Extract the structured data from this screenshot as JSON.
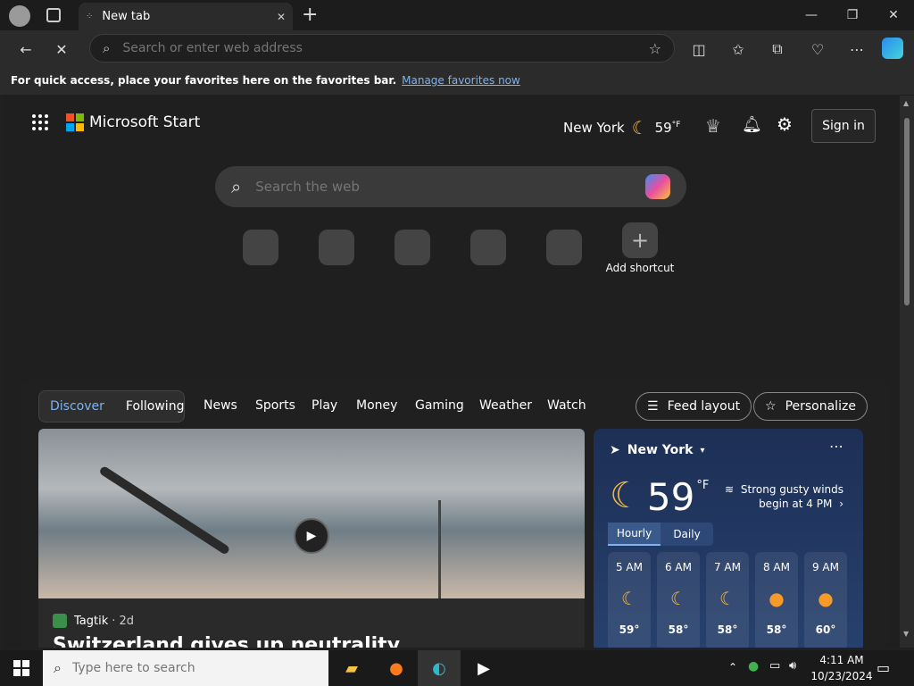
{
  "window": {
    "tab_title": "New tab",
    "close_tab": "✕",
    "new_tab": "+",
    "minimize": "—",
    "maximize": "❐",
    "close": "✕"
  },
  "toolbar": {
    "address_placeholder": "Search or enter web address"
  },
  "favbar": {
    "message": "For quick access, place your favorites here on the favorites bar.",
    "manage_link": "Manage favorites now"
  },
  "header": {
    "brand": "Microsoft Start",
    "city": "New York",
    "temp": "59",
    "unit": "°F",
    "sign_in": "Sign in"
  },
  "search": {
    "placeholder": "Search the web"
  },
  "shortcuts": {
    "add_label": "Add shortcut"
  },
  "feed": {
    "pill": [
      "Discover",
      "Following"
    ],
    "nav": [
      "News",
      "Sports",
      "Play",
      "Money",
      "Gaming",
      "Weather",
      "Watch"
    ],
    "feed_layout": "Feed layout",
    "personalize": "Personalize",
    "hero": {
      "source": "Tagtik",
      "age": "· 2d",
      "headline": "Switzerland gives up neutrality"
    }
  },
  "weather_card": {
    "location": "New York",
    "temp": "59",
    "unit": "°F",
    "alert": "Strong gusty winds begin at 4 PM",
    "tabs": [
      "Hourly",
      "Daily"
    ],
    "hours": [
      {
        "time": "5 AM",
        "icon": "moon",
        "temp": "59°"
      },
      {
        "time": "6 AM",
        "icon": "moon",
        "temp": "58°"
      },
      {
        "time": "7 AM",
        "icon": "moon",
        "temp": "58°"
      },
      {
        "time": "8 AM",
        "icon": "sun",
        "temp": "58°"
      },
      {
        "time": "9 AM",
        "icon": "sun",
        "temp": "60°"
      }
    ]
  },
  "taskbar": {
    "search_placeholder": "Type here to search",
    "time": "4:11 AM",
    "date": "10/23/2024"
  },
  "colors": {
    "accent": "#7fb2ee",
    "ms_red": "#f25022",
    "ms_green": "#7fba00",
    "ms_blue": "#00a4ef",
    "ms_yellow": "#ffb900"
  }
}
